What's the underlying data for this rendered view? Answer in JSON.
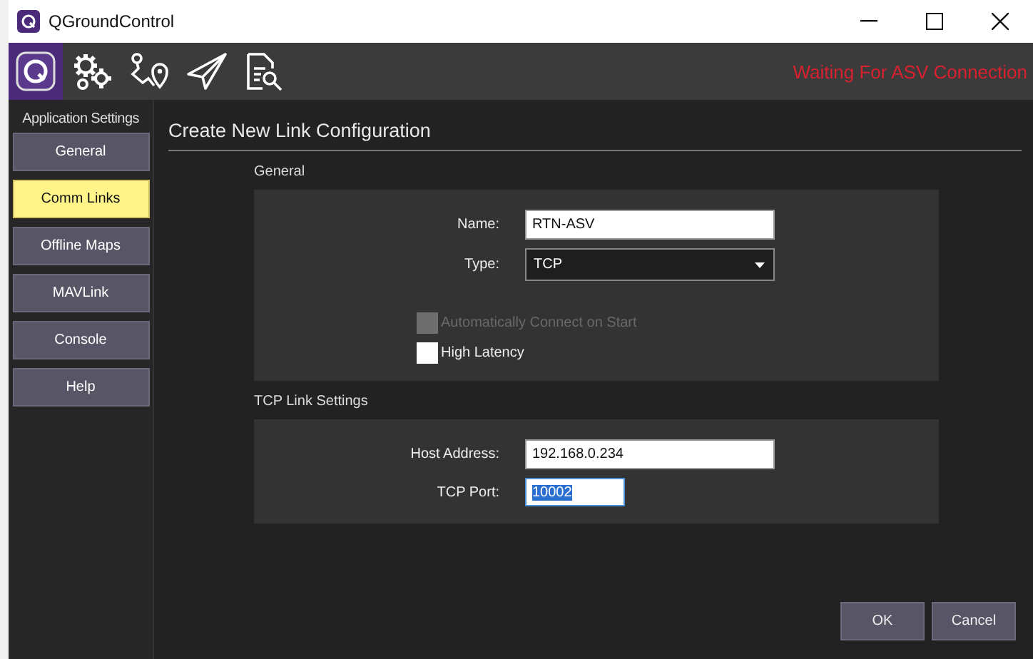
{
  "window": {
    "title": "QGroundControl"
  },
  "toolbar": {
    "items": [
      {
        "kind": "logo",
        "selected": true
      },
      {
        "kind": "gears",
        "selected": false
      },
      {
        "kind": "route",
        "selected": false
      },
      {
        "kind": "plane",
        "selected": false
      },
      {
        "kind": "doc",
        "selected": false
      }
    ],
    "status": "Waiting For ASV Connection"
  },
  "sidebar": {
    "heading": "Application Settings",
    "items": [
      {
        "label": "General",
        "selected": false
      },
      {
        "label": "Comm Links",
        "selected": true
      },
      {
        "label": "Offline Maps",
        "selected": false
      },
      {
        "label": "MAVLink",
        "selected": false
      },
      {
        "label": "Console",
        "selected": false
      },
      {
        "label": "Help",
        "selected": false
      }
    ]
  },
  "page_title": "Create New Link Configuration",
  "sections": [
    {
      "heading": "General",
      "rows": [
        {
          "kind": "text",
          "label": "Name:",
          "value": "RTN-ASV"
        },
        {
          "kind": "dropdown",
          "label": "Type:",
          "value": "TCP"
        },
        {
          "kind": "checkbox",
          "label": "Automatically Connect on Start",
          "checked": false,
          "disabled": true
        },
        {
          "kind": "checkbox",
          "label": "High Latency",
          "checked": false,
          "disabled": false
        }
      ]
    },
    {
      "heading": "TCP Link Settings",
      "rows": [
        {
          "kind": "text",
          "label": "Host Address:",
          "value": "192.168.0.234"
        },
        {
          "kind": "short",
          "label": "TCP Port:",
          "value": "10002",
          "text_selected": true
        }
      ]
    }
  ],
  "buttons": [
    "OK",
    "Cancel"
  ]
}
